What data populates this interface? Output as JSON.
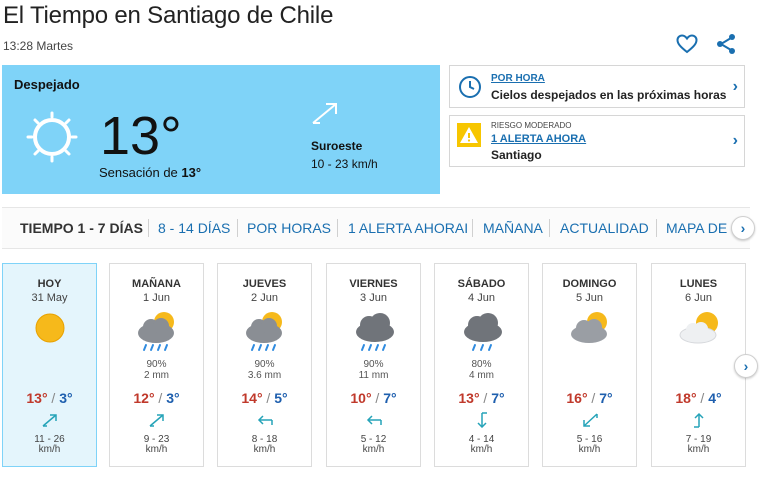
{
  "header": {
    "title": "El Tiempo en Santiago de Chile",
    "time": "13:28 Martes",
    "favorite_icon": "heart-icon",
    "share_icon": "share-icon"
  },
  "now": {
    "condition": "Despejado",
    "icon": "sun-outline-icon",
    "temperature": "13°",
    "feels_like_label": "Sensación de",
    "feels_like_value": "13°",
    "wind_direction": "Suroeste",
    "wind_speed": "10 - 23 km/h",
    "panel_color": "#7fd3f8"
  },
  "hourly_card": {
    "link": "POR HORA",
    "text": "Cielos despejados en las próximas horas"
  },
  "alert_card": {
    "level": "RIESGO MODERADO",
    "link": "1 ALERTA AHORA",
    "city": "Santiago",
    "alert_color": "#f7c600"
  },
  "tabs": [
    {
      "label": "TIEMPO 1 - 7 DÍAS",
      "active": true
    },
    {
      "label": "8 - 14 DÍAS",
      "active": false
    },
    {
      "label": "POR HORAS",
      "active": false
    },
    {
      "label": "1 ALERTA AHORAI",
      "active": false
    },
    {
      "label": "MAÑANA",
      "active": false
    },
    {
      "label": "ACTUALIDAD",
      "active": false
    },
    {
      "label": "MAPA DE",
      "active": false
    }
  ],
  "days": [
    {
      "name": "HOY",
      "date": "31 May",
      "icon": "sun-icon",
      "rain_pct": "",
      "rain_mm": "",
      "max": "13°",
      "min": "3°",
      "wind": "11 - 26",
      "wind_unit": "km/h"
    },
    {
      "name": "MAÑANA",
      "date": "1 Jun",
      "icon": "sun-cloud-rain-icon",
      "rain_pct": "90%",
      "rain_mm": "2 mm",
      "max": "12°",
      "min": "3°",
      "wind": "9 - 23",
      "wind_unit": "km/h"
    },
    {
      "name": "JUEVES",
      "date": "2 Jun",
      "icon": "sun-cloud-rain-icon",
      "rain_pct": "90%",
      "rain_mm": "3.6 mm",
      "max": "14°",
      "min": "5°",
      "wind": "8 - 18",
      "wind_unit": "km/h"
    },
    {
      "name": "VIERNES",
      "date": "3 Jun",
      "icon": "cloud-rain-icon",
      "rain_pct": "90%",
      "rain_mm": "11 mm",
      "max": "10°",
      "min": "7°",
      "wind": "5 - 12",
      "wind_unit": "km/h"
    },
    {
      "name": "SÁBADO",
      "date": "4 Jun",
      "icon": "cloud-rain-icon",
      "rain_pct": "80%",
      "rain_mm": "4 mm",
      "max": "13°",
      "min": "7°",
      "wind": "4 - 14",
      "wind_unit": "km/h"
    },
    {
      "name": "DOMINGO",
      "date": "5 Jun",
      "icon": "sun-cloud-icon",
      "rain_pct": "",
      "rain_mm": "",
      "max": "16°",
      "min": "7°",
      "wind": "5 - 16",
      "wind_unit": "km/h"
    },
    {
      "name": "LUNES",
      "date": "6 Jun",
      "icon": "sun-behind-cloud-icon",
      "rain_pct": "",
      "rain_mm": "",
      "max": "18°",
      "min": "4°",
      "wind": "7 - 19",
      "wind_unit": "km/h"
    }
  ]
}
